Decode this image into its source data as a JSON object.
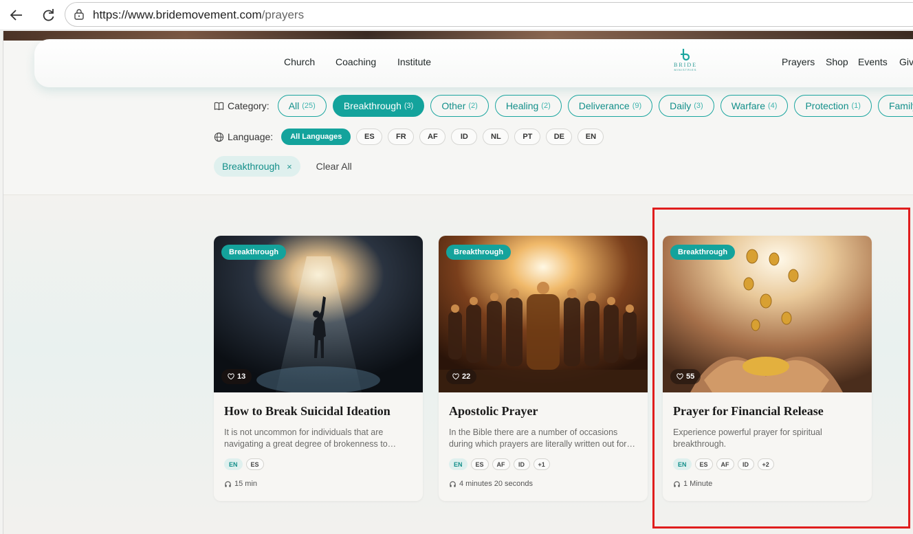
{
  "browser": {
    "url_host": "https://www.bridemovement.com",
    "url_path": "/prayers"
  },
  "nav": {
    "left": [
      "Church",
      "Coaching",
      "Institute"
    ],
    "right": [
      "Prayers",
      "Shop",
      "Events",
      "Give"
    ],
    "logo_text": "BRIDE",
    "logo_sub": "MINISTRIES"
  },
  "filters": {
    "category_label": "Category:",
    "categories": [
      {
        "label": "All",
        "count": "(25)",
        "active": false
      },
      {
        "label": "Breakthrough",
        "count": "(3)",
        "active": true
      },
      {
        "label": "Other",
        "count": "(2)",
        "active": false
      },
      {
        "label": "Healing",
        "count": "(2)",
        "active": false
      },
      {
        "label": "Deliverance",
        "count": "(9)",
        "active": false
      },
      {
        "label": "Daily",
        "count": "(3)",
        "active": false
      },
      {
        "label": "Warfare",
        "count": "(4)",
        "active": false
      },
      {
        "label": "Protection",
        "count": "(1)",
        "active": false
      },
      {
        "label": "Family",
        "count": "",
        "active": false
      }
    ],
    "language_label": "Language:",
    "languages": [
      "All Languages",
      "ES",
      "FR",
      "AF",
      "ID",
      "NL",
      "PT",
      "DE",
      "EN"
    ],
    "active_filter": "Breakthrough",
    "active_filter_remove": "×",
    "clear_all": "Clear All"
  },
  "cards": [
    {
      "badge": "Breakthrough",
      "likes": "13",
      "title": "How to Break Suicidal Ideation",
      "description": "It is not uncommon for individuals that are navigating a great degree of brokenness to experience thoughts of hopelessness and despair.",
      "languages": [
        "EN",
        "ES"
      ],
      "duration": "15 min"
    },
    {
      "badge": "Breakthrough",
      "likes": "22",
      "title": "Apostolic Prayer",
      "description": "In the Bible there are a number of occasions during which prayers are literally written out for believers to pray.",
      "languages": [
        "EN",
        "ES",
        "AF",
        "ID",
        "+1"
      ],
      "duration": "4 minutes 20 seconds"
    },
    {
      "badge": "Breakthrough",
      "likes": "55",
      "title": "Prayer for Financial Release",
      "description": "Experience powerful prayer for spiritual breakthrough.",
      "languages": [
        "EN",
        "ES",
        "AF",
        "ID",
        "+2"
      ],
      "duration": "1 Minute"
    }
  ],
  "colors": {
    "accent": "#14a39c",
    "highlight": "#e01d1d"
  }
}
